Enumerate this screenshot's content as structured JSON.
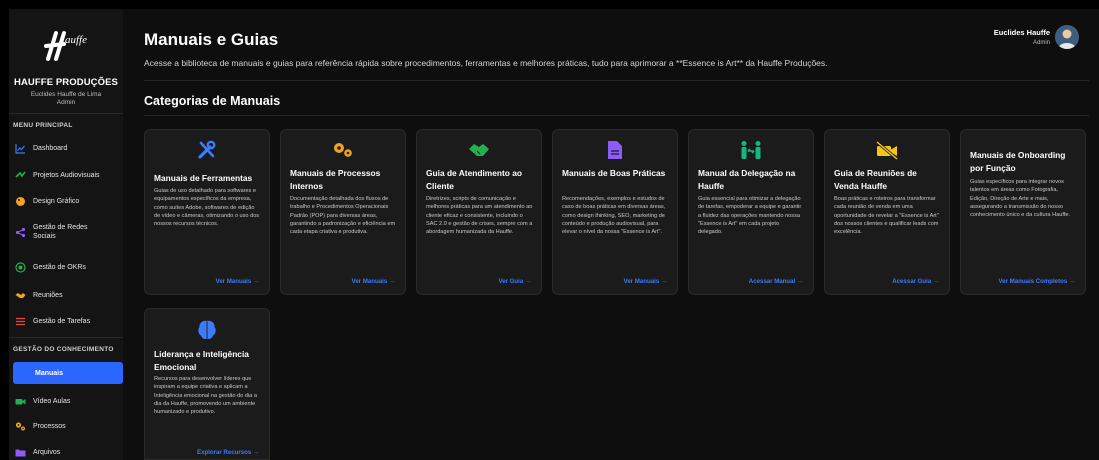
{
  "sidebar": {
    "brand": "HAUFFE PRODUÇÕES",
    "user_name": "Euclides Hauffe de Lima",
    "user_role": "Admin",
    "section_main": "MENU PRINCIPAL",
    "section_knowledge": "GESTÃO DO CONHECIMENTO",
    "items": [
      {
        "label": "Dashboard",
        "icon": "chart-icon"
      },
      {
        "label": "Projetos Audiovisuais",
        "icon": "video-icon"
      },
      {
        "label": "Design Gráfico",
        "icon": "palette-icon"
      },
      {
        "label": "Gestão de Redes Sociais",
        "icon": "share-icon"
      },
      {
        "label": "Gestão de OKRs",
        "icon": "target-icon"
      },
      {
        "label": "Reuniões",
        "icon": "handshake-icon"
      },
      {
        "label": "Gestão de Tarefas",
        "icon": "list-icon"
      }
    ],
    "knowledge_items": [
      {
        "label": "Manuais",
        "active": true
      },
      {
        "label": "Vídeo Aulas",
        "icon": "video-camera-icon"
      },
      {
        "label": "Processos",
        "icon": "gears-icon"
      },
      {
        "label": "Arquivos",
        "icon": "folder-icon"
      }
    ]
  },
  "header": {
    "title": "Manuais e Guias",
    "subtitle": "Acesse a biblioteca de manuais e guias para referência rápida sobre procedimentos, ferramentas e melhores práticas, tudo para aprimorar a **Essence is Art** da Hauffe Produções.",
    "user_name": "Euclides Hauffe",
    "user_role": "Admin"
  },
  "section_title": "Categorias de Manuais",
  "cards": [
    {
      "icon": "tools-icon",
      "color": "#3d7bff",
      "title": "Manuais de Ferramentas",
      "desc": "Guias de uso detalhado para softwares e equipamentos específicos da empresa, como suítes Adobe, softwares de edição de vídeo e câmeras, otimizando o uso dos nossos recursos técnicos.",
      "link": "Ver Manuais →"
    },
    {
      "icon": "gears-icon",
      "color": "#f2a31b",
      "title": "Manuais de Processos Internos",
      "desc": "Documentação detalhada dos fluxos de trabalho e Procedimentos Operacionais Padrão (POP) para diversas áreas, garantindo a padronização e eficiência em cada etapa criativa e produtiva.",
      "link": "Ver Manuais →"
    },
    {
      "icon": "handshake-icon",
      "color": "#22b14c",
      "title": "Guia de Atendimento ao Cliente",
      "desc": "Diretrizes, scripts de comunicação e melhores práticas para um atendimento ao cliente eficaz e consistente, incluindo o SAC 2.0 e gestão de crises, sempre com a abordagem humanizada da Hauffe.",
      "link": "Ver Guia →"
    },
    {
      "icon": "document-icon",
      "color": "#8b5cf6",
      "title": "Manuais de Boas Práticas",
      "desc": "Recomendações, exemplos e estudos de caso de boas práticas em diversas áreas, como design thinking, SEO, marketing de conteúdo e produção audiovisual, para elevar o nível da nossa \"Essence is Art\".",
      "link": "Ver Manuais →"
    },
    {
      "icon": "delegation-icon",
      "color": "#10b981",
      "title": "Manual da Delegação na Hauffe",
      "desc": "Guia essencial para otimizar a delegação de tarefas, empoderar a equipe e garantir a fluidez das operações mantendo nossa \"Essence is Art\" em cada projeto delegado.",
      "link": "Acessar Manual →"
    },
    {
      "icon": "no-video-icon",
      "color": "#f5c518",
      "title": "Guia de Reuniões de Venda Hauffe",
      "desc": "Boas práticas e roteiros para transformar cada reunião de venda em uma oportunidade de revelar a \"Essence is Art\" dos nossos clientes e qualificar leads com excelência.",
      "link": "Acessar Guia →"
    },
    {
      "icon": "",
      "color": "",
      "title": "Manuais de Onboarding por Função",
      "desc": "Guias específicos para integrar novos talentos em áreas como Fotografia, Edição, Direção de Arte e mais, assegurando a transmissão do nosso conhecimento único e da cultura Hauffe.",
      "link": "Ver Manuais Completos →"
    },
    {
      "icon": "brain-icon",
      "color": "#3d7bff",
      "title": "Liderança e Inteligência Emocional",
      "desc": "Recursos para desenvolver líderes que inspiram a equipe criativa e aplicam a Inteligência emocional na gestão do dia a dia da Hauffe, promovendo um ambiente humanizado e produtivo.",
      "link": "Explorar Recursos →"
    }
  ]
}
